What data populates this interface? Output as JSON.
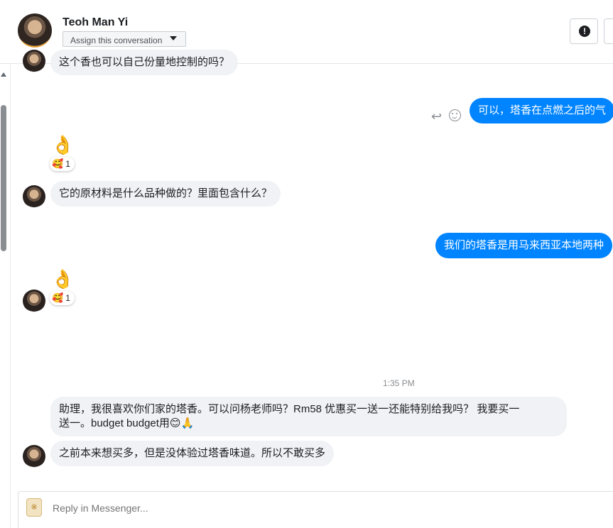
{
  "header": {
    "contact_name": "Teoh Man Yi",
    "assign_label": "Assign this conversation",
    "alert_icon": "exclamation-icon"
  },
  "messages": [
    {
      "id": "m0",
      "direction": "in",
      "text": "这个香也可以自己份量地控制的吗？"
    },
    {
      "id": "m1",
      "direction": "out",
      "text": "可以，塔香在点燃之后的气"
    },
    {
      "id": "m2",
      "direction": "in",
      "emoji": "👌",
      "reaction": {
        "icon": "🥰",
        "count": "1"
      }
    },
    {
      "id": "m3",
      "direction": "in",
      "text": "它的原材料是什么品种做的？里面包含什么？"
    },
    {
      "id": "m4",
      "direction": "out",
      "text": "我们的塔香是用马来西亚本地两种"
    },
    {
      "id": "m5",
      "direction": "in",
      "emoji": "👌",
      "reaction": {
        "icon": "🥰",
        "count": "1"
      }
    },
    {
      "id": "m6",
      "direction": "in",
      "text_line1": "助理，我很喜欢你们家的塔香。可以问杨老师吗？Rm58 优惠买一送一还能特别给我吗？ 我要买一",
      "text_line2": "送一。budget budget用😊🙏"
    },
    {
      "id": "m7",
      "direction": "in",
      "text": "之前本来想买多，但是没体验过塔香味道。所以不敢买多"
    }
  ],
  "timestamp": "1:35 PM",
  "composer": {
    "placeholder": "Reply in Messenger..."
  },
  "colors": {
    "outgoing_bubble": "#0084ff",
    "incoming_bubble": "#f0f2f5"
  }
}
